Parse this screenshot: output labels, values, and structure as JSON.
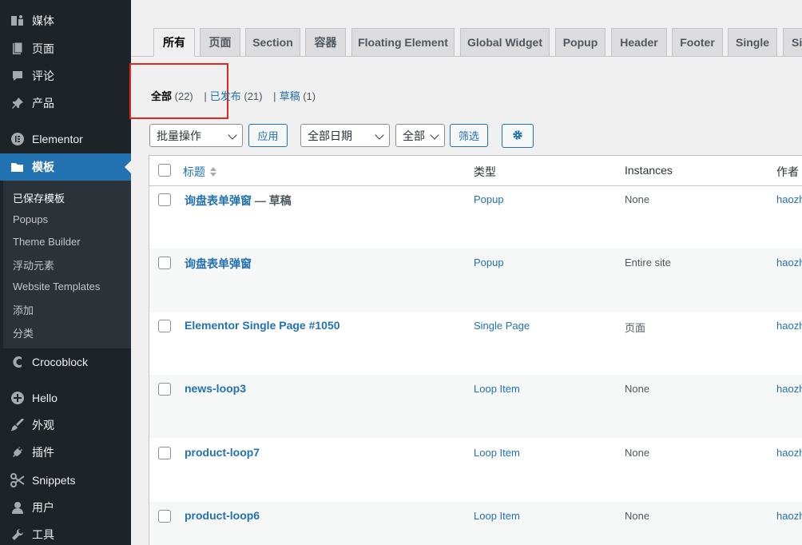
{
  "sidebar": {
    "items": [
      {
        "label": "媒体",
        "icon": "media-icon"
      },
      {
        "label": "页面",
        "icon": "page-icon"
      },
      {
        "label": "评论",
        "icon": "comment-icon"
      },
      {
        "label": "产品",
        "icon": "pin-icon"
      },
      {
        "label": "Elementor",
        "icon": "elementor-icon"
      },
      {
        "label": "模板",
        "icon": "folder-icon"
      },
      {
        "label": "Crocoblock",
        "icon": "crocoblock-icon"
      },
      {
        "label": "Hello",
        "icon": "plus-circle-icon"
      },
      {
        "label": "外观",
        "icon": "brush-icon"
      },
      {
        "label": "插件",
        "icon": "plug-icon"
      },
      {
        "label": "Snippets",
        "icon": "scissors-icon"
      },
      {
        "label": "用户",
        "icon": "user-icon"
      },
      {
        "label": "工具",
        "icon": "wrench-icon"
      }
    ],
    "submenu": [
      "已保存模板",
      "Popups",
      "Theme Builder",
      "浮动元素",
      "Website Templates",
      "添加",
      "分类"
    ]
  },
  "tabs": [
    "所有",
    "页面",
    "Section",
    "容器",
    "Floating Element",
    "Global Widget",
    "Popup",
    "Header",
    "Footer",
    "Single",
    "Si"
  ],
  "filters": {
    "all_label": "全部",
    "all_count": "(22)",
    "published_label": "已发布",
    "published_count": "(21)",
    "draft_label": "草稿",
    "draft_count": "(1)",
    "separator": "|"
  },
  "toolbar": {
    "bulk_action": "批量操作",
    "apply": "应用",
    "date_filter": "全部日期",
    "type_filter": "全部",
    "filter_button": "筛选",
    "settings_icon": "gear-icon"
  },
  "table": {
    "headers": {
      "title": "标题",
      "type": "类型",
      "instances": "Instances",
      "author": "作者"
    },
    "rows": [
      {
        "title": "询盘表单弹窗",
        "state": " — 草稿",
        "type": "Popup",
        "instances": "None",
        "author": "haozh"
      },
      {
        "title": "询盘表单弹窗",
        "state": "",
        "type": "Popup",
        "instances": "Entire site",
        "author": "haozh"
      },
      {
        "title": "Elementor Single Page #1050",
        "state": "",
        "type": "Single Page",
        "instances": "页面",
        "author": "haozh"
      },
      {
        "title": "news-loop3",
        "state": "",
        "type": "Loop Item",
        "instances": "None",
        "author": "haozh"
      },
      {
        "title": "product-loop7",
        "state": "",
        "type": "Loop Item",
        "instances": "None",
        "author": "haozh"
      },
      {
        "title": "product-loop6",
        "state": "",
        "type": "Loop Item",
        "instances": "None",
        "author": "haozh"
      }
    ]
  },
  "colors": {
    "accent": "#2271b1",
    "sidebar": "#1d2327",
    "highlight": "#e0281e"
  }
}
